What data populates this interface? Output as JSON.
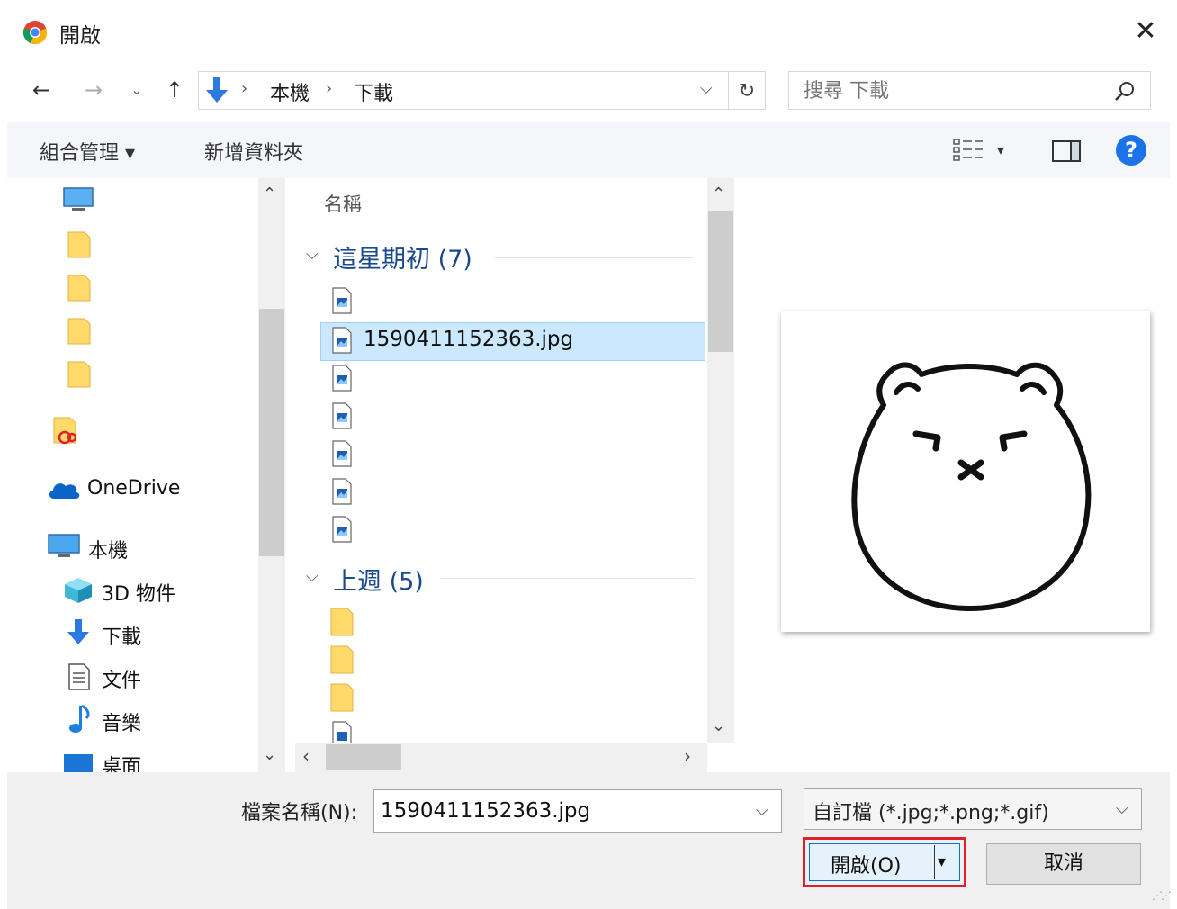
{
  "window": {
    "title": "開啟",
    "close_label": "✕"
  },
  "nav": {
    "back": "←",
    "forward": "→",
    "recent": "⌄",
    "up": "↑",
    "breadcrumb": [
      "本機",
      "下載"
    ],
    "separator": "›",
    "dropdown": "⌵",
    "refresh": "↻"
  },
  "search": {
    "placeholder": "搜尋 下載"
  },
  "toolbar": {
    "organize": "組合管理 ▾",
    "new_folder": "新增資料夾",
    "view_caret": "▾",
    "help": "?"
  },
  "sidebar": {
    "items": [
      {
        "label": "OneDrive",
        "icon": "onedrive-icon"
      },
      {
        "label": "本機",
        "icon": "pc-icon"
      },
      {
        "label": "3D 物件",
        "icon": "3d-objects-icon"
      },
      {
        "label": "下載",
        "icon": "download-icon"
      },
      {
        "label": "文件",
        "icon": "document-icon"
      },
      {
        "label": "音樂",
        "icon": "music-icon"
      },
      {
        "label": "桌面",
        "icon": "desktop-icon"
      }
    ],
    "scroll_up": "⌃",
    "scroll_down": "⌄"
  },
  "file_list": {
    "column_name": "名稱",
    "groups": [
      {
        "chevron": "⌵",
        "label": "這星期初 (7)"
      },
      {
        "chevron": "⌵",
        "label": "上週 (5)"
      }
    ],
    "selected_file": "1590411152363.jpg",
    "scroll_up": "⌃",
    "scroll_down": "⌄",
    "scroll_left": "‹",
    "scroll_right": "›"
  },
  "bottom": {
    "filename_label": "檔案名稱(N):",
    "filename_value": "1590411152363.jpg",
    "dropdown": "⌵",
    "filetype": "自訂檔 (*.jpg;*.png;*.gif)",
    "open_label": "開啟(O)",
    "open_caret": "▾",
    "cancel_label": "取消"
  },
  "colors": {
    "accent": "#0078d7",
    "selection": "#cce8ff",
    "highlight_border": "#e0202a",
    "group_header": "#1a4a8c"
  }
}
